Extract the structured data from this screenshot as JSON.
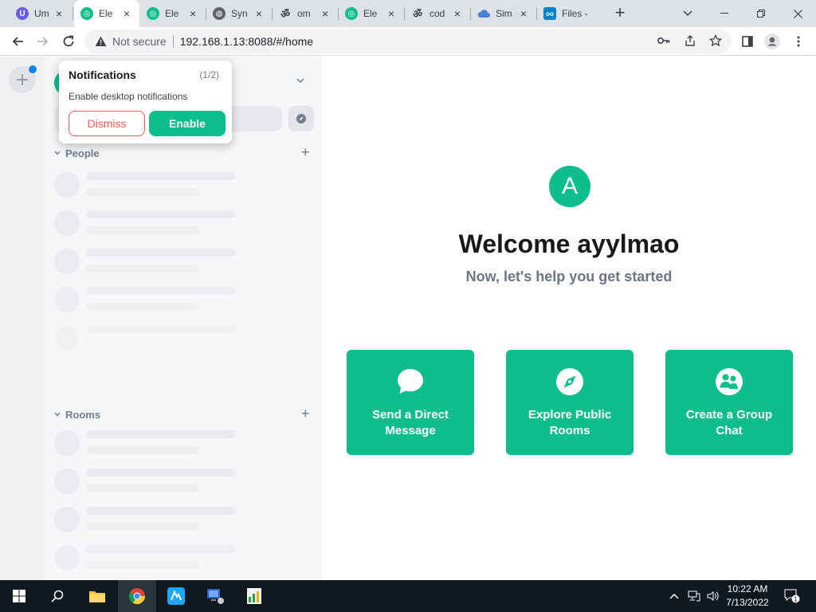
{
  "browser": {
    "tabs": [
      {
        "title": "Um",
        "icon": "umami-icon",
        "color": "#6b5ce7",
        "active": false
      },
      {
        "title": "Ele",
        "icon": "element-icon",
        "color": "#0dbd8b",
        "active": true
      },
      {
        "title": "Ele",
        "icon": "element-icon",
        "color": "#0dbd8b",
        "active": false
      },
      {
        "title": "Syn",
        "icon": "globe-icon",
        "color": "#5f6368",
        "active": false
      },
      {
        "title": "om",
        "icon": "omnisearch-icon",
        "color": "#3c4043",
        "active": false
      },
      {
        "title": "Ele",
        "icon": "element-icon",
        "color": "#0dbd8b",
        "active": false
      },
      {
        "title": "cod",
        "icon": "omnisearch-icon",
        "color": "#3c4043",
        "active": false
      },
      {
        "title": "Sim",
        "icon": "cloud-icon",
        "color": "#4a7fd4",
        "active": false
      },
      {
        "title": "Files - N",
        "icon": "nextcloud-icon",
        "color": "#0082c9",
        "active": false
      }
    ],
    "new_tab": "+",
    "security_label": "Not secure",
    "url": "192.168.1.13:8088/#/home"
  },
  "app": {
    "sections": {
      "people": "People",
      "rooms": "Rooms"
    },
    "welcome_title": "Welcome ayylmao",
    "welcome_subtitle": "Now, let's help you get started",
    "avatar_letter": "A",
    "cards": [
      {
        "label": "Send a Direct Message",
        "icon": "chat-bubble-icon"
      },
      {
        "label": "Explore Public Rooms",
        "icon": "compass-icon"
      },
      {
        "label": "Create a Group Chat",
        "icon": "group-icon"
      }
    ],
    "accent": "#0dbd8b"
  },
  "notification": {
    "title": "Notifications",
    "count": "(1/2)",
    "description": "Enable desktop notifications",
    "dismiss_label": "Dismiss",
    "enable_label": "Enable"
  },
  "taskbar": {
    "time": "10:22 AM",
    "date": "7/13/2022",
    "notification_count": "1"
  }
}
